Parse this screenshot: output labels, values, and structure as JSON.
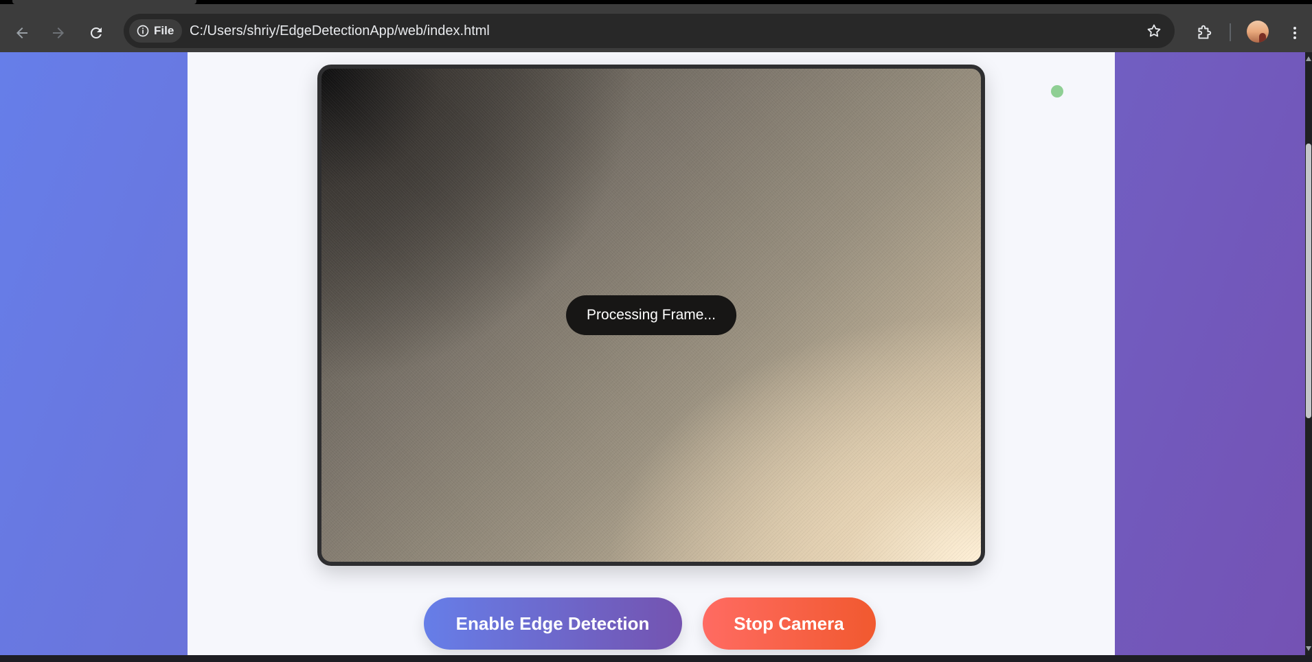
{
  "browser": {
    "address_chip": "File",
    "url": "C:/Users/shriy/EdgeDetectionApp/web/index.html",
    "icons": [
      "back-arrow-icon",
      "forward-arrow-icon",
      "reload-icon",
      "info-icon",
      "bookmark-star-icon",
      "extensions-puzzle-icon",
      "profile-avatar",
      "more-menu-icon"
    ]
  },
  "app": {
    "overlay_text": "Processing Frame...",
    "status_color": "#8fcf94",
    "buttons": {
      "edge_detection": "Enable Edge Detection",
      "stop_camera": "Stop Camera"
    },
    "colors": {
      "background_gradient": [
        "#667ee9",
        "#7452b4"
      ],
      "edge_button_gradient": [
        "#667ee8",
        "#7453b0"
      ],
      "stop_button_gradient": [
        "#ff6b62",
        "#f1592f"
      ],
      "panel": "#f6f7fc"
    }
  }
}
